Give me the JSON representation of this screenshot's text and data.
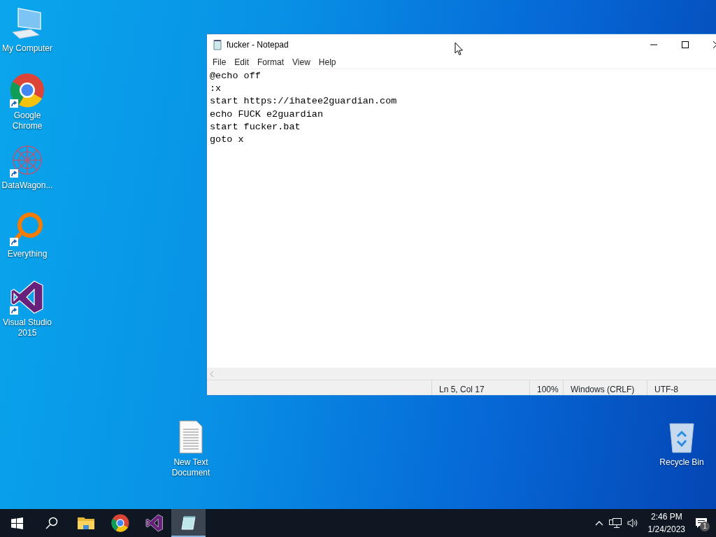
{
  "desktop_icons": [
    {
      "kind": "computer",
      "label": "My Computer",
      "shortcut": false
    },
    {
      "kind": "chrome",
      "label": "Google Chrome",
      "shortcut": true
    },
    {
      "kind": "datawagon",
      "label": "DataWagon...",
      "shortcut": true
    },
    {
      "kind": "everything",
      "label": "Everything",
      "shortcut": true
    },
    {
      "kind": "visualstudio",
      "label": "Visual Studio 2015",
      "shortcut": true
    },
    {
      "kind": "textdoc",
      "label": "New Text Document",
      "shortcut": false
    },
    {
      "kind": "recycle",
      "label": "Recycle Bin",
      "shortcut": false
    }
  ],
  "window": {
    "title": "fucker - Notepad",
    "menu": [
      "File",
      "Edit",
      "Format",
      "View",
      "Help"
    ],
    "lines": [
      "@echo off",
      ":x",
      "start https://ihatee2guardian.com",
      "echo FUCK e2guardian",
      "start fucker.bat",
      "goto x"
    ],
    "status_bar": [
      "Ln 5, Col 17",
      "100%",
      "Windows (CRLF)",
      "UTF-8"
    ]
  },
  "taskbar": {
    "items": [
      {
        "kind": "start",
        "selected": false
      },
      {
        "kind": "search",
        "selected": false
      },
      {
        "kind": "explorer",
        "selected": false
      },
      {
        "kind": "chrome",
        "selected": false
      },
      {
        "kind": "visualstudio",
        "selected": false
      },
      {
        "kind": "notepad",
        "selected": true
      }
    ],
    "time": "2:46 PM",
    "date": "1/24/2023",
    "notification_count": "1"
  }
}
